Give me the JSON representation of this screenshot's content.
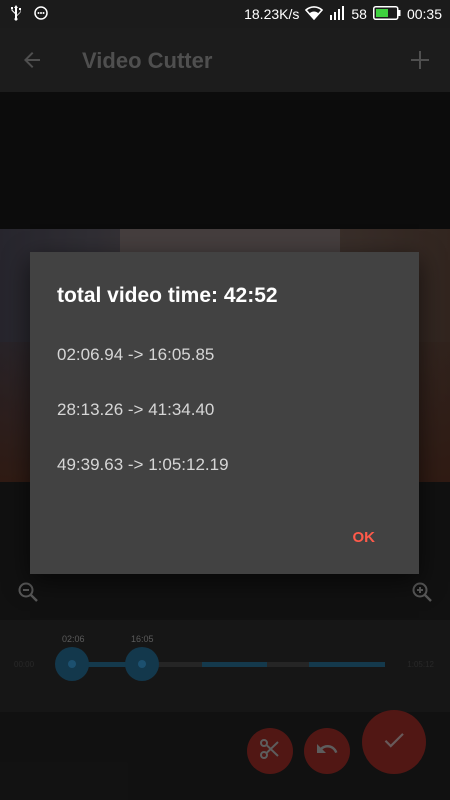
{
  "status_bar": {
    "network_speed": "18.23K/s",
    "battery_level": "58",
    "time": "00:35",
    "icons": [
      "usb-icon",
      "notification-icon",
      "wifi-icon",
      "signal-icon",
      "battery-icon"
    ]
  },
  "app_bar": {
    "title": "Video Cutter",
    "back_icon": "arrow-left-icon",
    "add_icon": "plus-icon"
  },
  "timeline": {
    "start_time": "00:00",
    "end_time": "1:05:12",
    "handle_left_label": "02:06",
    "handle_right_label": "16:05",
    "accent_color": "#1f5875"
  },
  "actions": {
    "cut_icon": "scissors-icon",
    "undo_icon": "undo-icon",
    "confirm_icon": "check-icon",
    "fab_color": "#7d2420"
  },
  "dialog": {
    "title": "total video time: 42:52",
    "segments": [
      "02:06.94 -> 16:05.85",
      "28:13.26 -> 41:34.40",
      "49:39.63 -> 1:05:12.19"
    ],
    "ok_label": "OK",
    "ok_color": "#ff5a4a"
  }
}
